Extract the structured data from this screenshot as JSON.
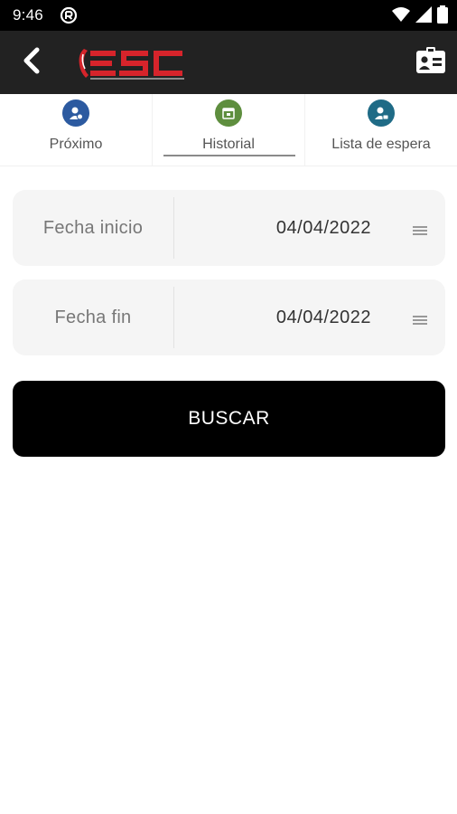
{
  "status_bar": {
    "time": "9:46"
  },
  "app_bar": {
    "logo_text": "ESC"
  },
  "tabs": [
    {
      "label": "Próximo",
      "icon": "user-clock-icon",
      "color": "#2c5aa0",
      "selected": false
    },
    {
      "label": "Historial",
      "icon": "calendar-icon",
      "color": "#5e8e3e",
      "selected": true
    },
    {
      "label": "Lista de espera",
      "icon": "user-waitlist-icon",
      "color": "#1f6b86",
      "selected": false
    }
  ],
  "form": {
    "start_date": {
      "label": "Fecha inicio",
      "value": "04/04/2022"
    },
    "end_date": {
      "label": "Fecha fin",
      "value": "04/04/2022"
    },
    "search_label": "BUSCAR"
  },
  "colors": {
    "app_bar": "#222222",
    "status_bar": "#000000",
    "logo_red": "#d6242b",
    "field_bg": "#f5f5f5",
    "button_bg": "#000000"
  }
}
